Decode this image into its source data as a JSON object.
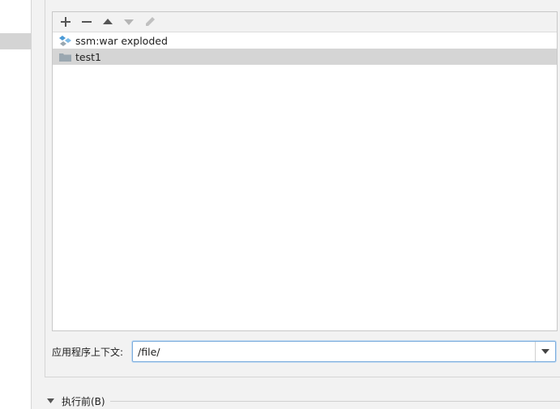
{
  "toolbar": {
    "add_icon": "plus-icon",
    "remove_icon": "minus-icon",
    "up_icon": "arrow-up-icon",
    "down_icon": "arrow-down-icon",
    "edit_icon": "pencil-icon"
  },
  "artifacts": [
    {
      "label": "ssm:war exploded",
      "icon": "artifact-icon",
      "selected": false
    },
    {
      "label": "test1",
      "icon": "folder-icon",
      "selected": true
    }
  ],
  "context": {
    "label": "应用程序上下文:",
    "value": "/file/"
  },
  "before_launch": {
    "label": "执行前(B)"
  },
  "colors": {
    "accent_border": "#7eaedd",
    "selection": "#d5d5d5",
    "artifact_blue": "#4a9ad6",
    "folder_gray": "#9aa7b0"
  }
}
